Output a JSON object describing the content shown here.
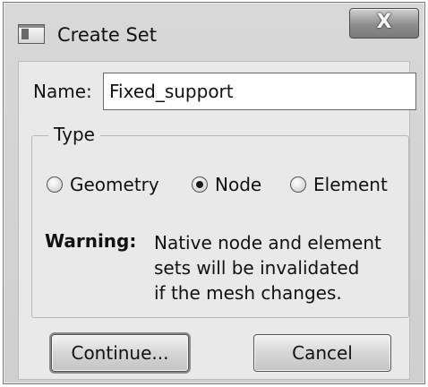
{
  "window": {
    "title": "Create Set",
    "close_label": "X"
  },
  "name_field": {
    "label": "Name:",
    "value": "Fixed_support"
  },
  "type_group": {
    "legend": "Type",
    "options": [
      {
        "label": "Geometry",
        "selected": false
      },
      {
        "label": "Node",
        "selected": true
      },
      {
        "label": "Element",
        "selected": false
      }
    ]
  },
  "warning": {
    "label": "Warning:",
    "lines": [
      "Native node and element",
      "sets will be invalidated",
      "if the mesh changes."
    ]
  },
  "buttons": {
    "continue_label": "Continue...",
    "cancel_label": "Cancel"
  }
}
